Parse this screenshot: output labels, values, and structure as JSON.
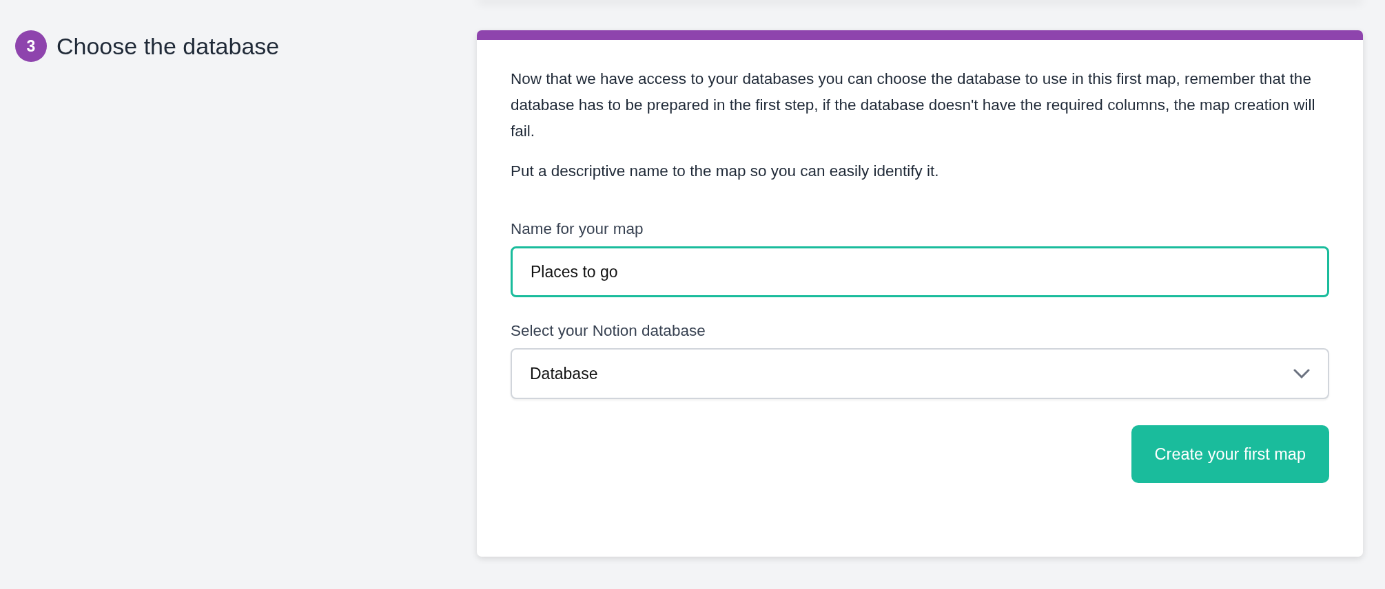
{
  "step": {
    "number": "3",
    "title": "Choose the database"
  },
  "card": {
    "paragraphs": [
      "Now that we have access to your databases you can choose the database to use in this first map, remember that the database has to be prepared in the first step, if the database doesn't have the required columns, the map creation will fail.",
      "Put a descriptive name to the map so you can easily identify it."
    ],
    "fields": [
      {
        "kind": "text",
        "label": "Name for your map",
        "value": "Places to go",
        "focused": true
      },
      {
        "kind": "select",
        "label": "Select your Notion database",
        "value": "Database",
        "focused": false
      }
    ],
    "button": "Create your first map"
  }
}
